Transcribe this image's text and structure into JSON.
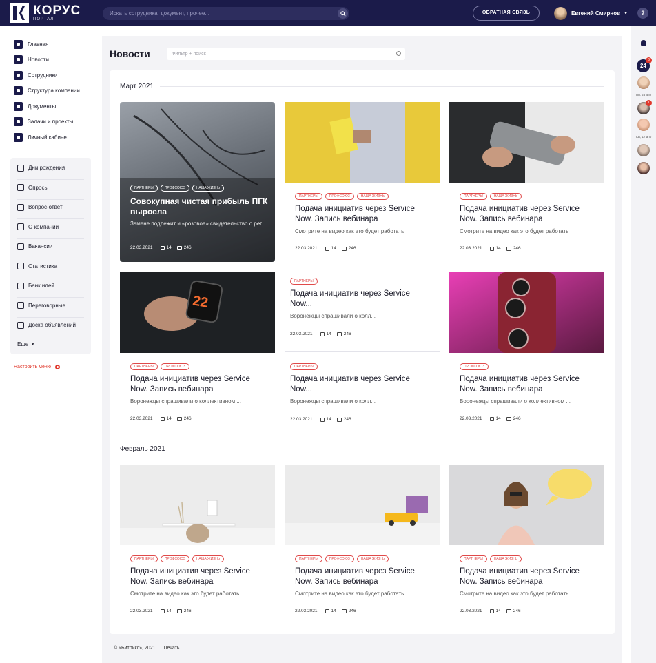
{
  "header": {
    "logo_title": "КОРУС",
    "logo_sub": "ПОРТАЛ",
    "search_placeholder": "Искать сотрудника, документ, прочее...",
    "feedback_label": "ОБРАТНАЯ СВЯЗЬ",
    "user_name": "Евгений Смирнов",
    "help_label": "?"
  },
  "nav": {
    "items": [
      {
        "label": "Главная"
      },
      {
        "label": "Новости"
      },
      {
        "label": "Сотрудники"
      },
      {
        "label": "Структура компании"
      },
      {
        "label": "Документы"
      },
      {
        "label": "Задачи и проекты"
      },
      {
        "label": "Личный кабинет"
      }
    ]
  },
  "subnav": {
    "items": [
      {
        "label": "Дни рождения"
      },
      {
        "label": "Опросы"
      },
      {
        "label": "Вопрос-ответ"
      },
      {
        "label": "О компании"
      },
      {
        "label": "Вакансии"
      },
      {
        "label": "Статистика"
      },
      {
        "label": "Банк идей"
      },
      {
        "label": "Переговорные"
      },
      {
        "label": "Доска объявлений"
      }
    ],
    "more_label": "Еще",
    "configure_label": "Настроить меню"
  },
  "page": {
    "title": "Новости",
    "filter_placeholder": "Фильтр + поиск"
  },
  "sections": [
    {
      "month": "Март 2021"
    },
    {
      "month": "Февраль 2021"
    }
  ],
  "cards": [
    {
      "tags": [
        "ПАРТНЕРЫ",
        "ПРОФСОЮЗ",
        "НАША ЖИЗНЬ"
      ],
      "title": "Совокупная чистая прибыль ПГК выросла",
      "desc": "Замене подлежит и «розовое» свидетельство о рег...",
      "date": "22.03.2021",
      "likes": "14",
      "comments": "246"
    },
    {
      "tags": [
        "ПАРТНЕРЫ",
        "ПРОФСОЮЗ",
        "НАША ЖИЗНЬ"
      ],
      "title": "Подача инициатив через Service Now. Запись вебинара",
      "desc": "Смотрите на видео как это будет работать",
      "date": "22.03.2021",
      "likes": "14",
      "comments": "246"
    },
    {
      "tags": [
        "ПАРТНЕРЫ",
        "НАША ЖИЗНЬ"
      ],
      "title": "Подача инициатив через Service Now. Запись вебинара",
      "desc": "Смотрите на видео как это будет работать",
      "date": "22.03.2021",
      "likes": "14",
      "comments": "246"
    },
    {
      "tags": [
        "ПАРТНЕРЫ",
        "ПРОФСОЮЗ"
      ],
      "title": "Подача инициатив через Service Now. Запись вебинара",
      "desc": "Воронежцы спрашивали о коллективном ...",
      "date": "22.03.2021",
      "likes": "14",
      "comments": "246"
    },
    {
      "tags": [
        "ПАРТНЕРЫ"
      ],
      "title": "Подача инициатив через Service Now...",
      "desc": "Воронежцы спрашивали о колл...",
      "date": "22.03.2021",
      "likes": "14",
      "comments": "246"
    },
    {
      "tags": [
        "ПАРТНЕРЫ"
      ],
      "title": "Подача инициатив через Service Now...",
      "desc": "Воронежцы спрашивали о колл...",
      "date": "22.03.2021",
      "likes": "14",
      "comments": "246"
    },
    {
      "tags": [
        "ПРОФСОЮЗ"
      ],
      "title": "Подача инициатив через Service Now. Запись вебинара",
      "desc": "Воронежцы спрашивали о коллективном ...",
      "date": "22.03.2021",
      "likes": "14",
      "comments": "246"
    },
    {
      "tags": [
        "ПАРТНЕРЫ",
        "ПРОФСОЮЗ",
        "НАША ЖИЗНЬ"
      ],
      "title": "Подача инициатив через Service Now. Запись вебинара",
      "desc": "Смотрите на видео как это будет работать",
      "date": "22.03.2021",
      "likes": "14",
      "comments": "246"
    },
    {
      "tags": [
        "ПАРТНЕРЫ",
        "ПРОФСОЮЗ",
        "НАША ЖИЗНЬ"
      ],
      "title": "Подача инициатив через Service Now. Запись вебинара",
      "desc": "Смотрите на видео как это будет работать",
      "date": "22.03.2021",
      "likes": "14",
      "comments": "246"
    },
    {
      "tags": [
        "ПАРТНЕРЫ",
        "НАША ЖИЗНЬ"
      ],
      "title": "Подача инициатив через Service Now. Запись вебинара",
      "desc": "Смотрите на видео как это будет работать",
      "date": "22.03.2021",
      "likes": "14",
      "comments": "246"
    }
  ],
  "footer": {
    "copyright": "© «Битрикс», 2021",
    "print_label": "Печать"
  },
  "rightbar": {
    "calendar_badge": "24",
    "counts": [
      "6",
      "1"
    ],
    "dates": [
      "Пн, 26 апр",
      "СБ, 17 апр"
    ]
  },
  "colors": {
    "header_bg": "#1b1b4a",
    "accent_red": "#e0382c",
    "panel_bg": "#f3f3f6"
  }
}
